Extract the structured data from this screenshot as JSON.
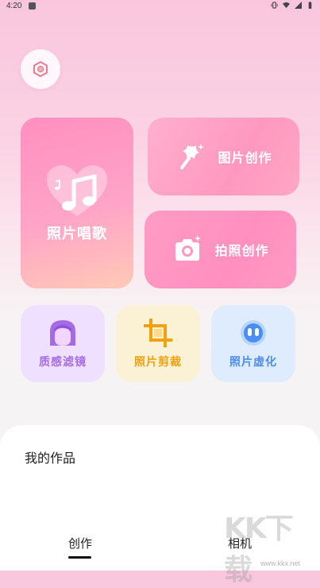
{
  "status_bar": {
    "time": "4:20",
    "icons": [
      "notification-icon",
      "vibrate-icon",
      "wifi-icon",
      "signal-icon",
      "battery-icon"
    ]
  },
  "settings": {
    "icon": "hexagon-settings-icon"
  },
  "features": {
    "photo_song": {
      "label": "照片唱歌",
      "icon": "music-note-heart-icon"
    },
    "image_create": {
      "label": "图片创作",
      "icon": "magic-wand-star-icon"
    },
    "photo_create": {
      "label": "拍照创作",
      "icon": "camera-icon"
    }
  },
  "tools": [
    {
      "label": "质感滤镜",
      "icon": "girl-face-icon",
      "color": "#a76ce6"
    },
    {
      "label": "照片剪裁",
      "icon": "crop-icon",
      "color": "#f2a210"
    },
    {
      "label": "照片虚化",
      "icon": "blur-face-icon",
      "color": "#4a8ef5"
    }
  ],
  "works": {
    "title": "我的作品",
    "tabs": [
      {
        "label": "创作",
        "active": true
      },
      {
        "label": "相机",
        "active": false
      }
    ]
  },
  "watermark": {
    "logo": "KK下载",
    "url": "www.kkx.net"
  }
}
